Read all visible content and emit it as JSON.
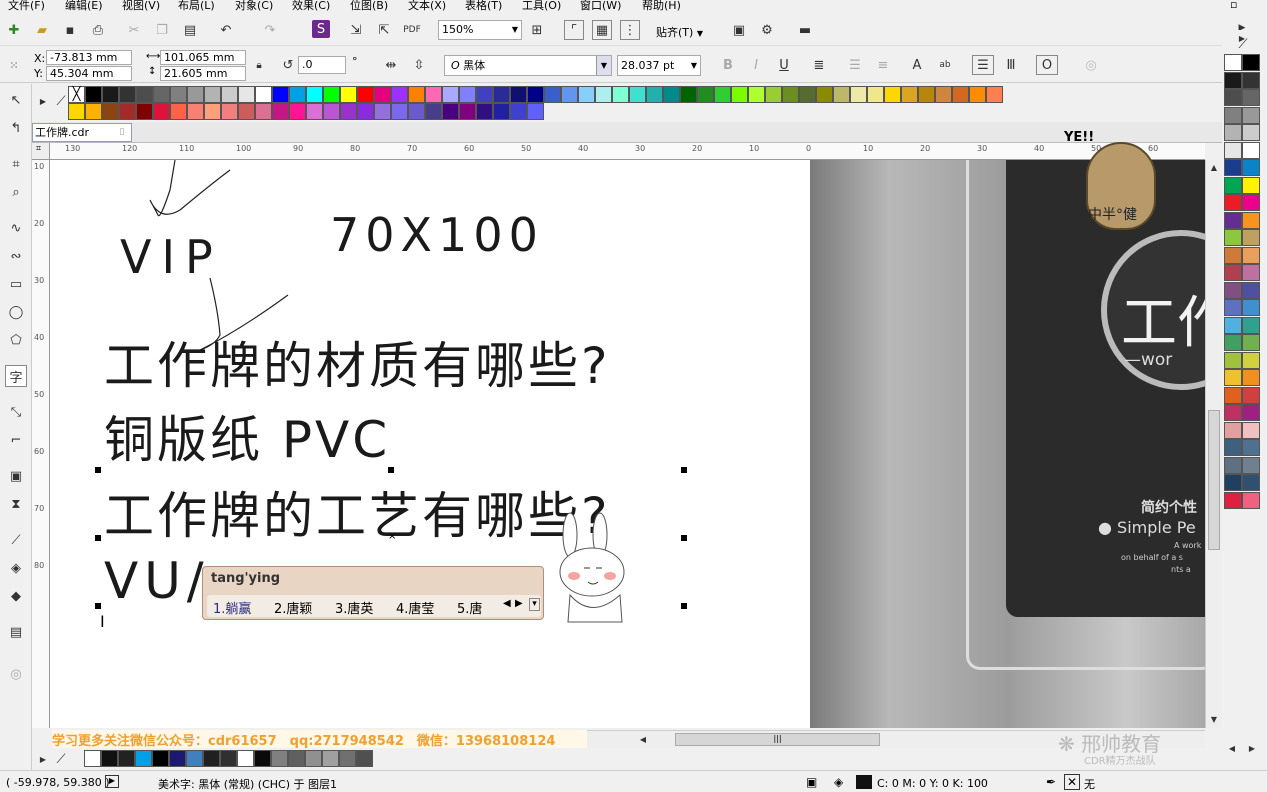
{
  "menu": [
    "文件(F)",
    "编辑(E)",
    "视图(V)",
    "布局(L)",
    "对象(C)",
    "效果(C)",
    "位图(B)",
    "文本(X)",
    "表格(T)",
    "工具(O)",
    "窗口(W)",
    "帮助(H)"
  ],
  "toolbar": {
    "zoom": "150%",
    "snap_label": "贴齐(T)"
  },
  "property_bar": {
    "x_label": "X:",
    "x_value": "-73.813 mm",
    "y_label": "Y:",
    "y_value": "45.304 mm",
    "width_value": "101.065 mm",
    "height_value": "21.605 mm",
    "rotation_value": ".0",
    "rotation_unit": "°",
    "font_name": "黑体",
    "font_size": "28.037 pt"
  },
  "doc_tab": "工作牌.cdr",
  "ruler_top": [
    "130",
    "120",
    "110",
    "100",
    "90",
    "80",
    "70",
    "60",
    "50",
    "40",
    "30",
    "20",
    "10",
    "0",
    "10",
    "20",
    "30",
    "40",
    "50",
    "60"
  ],
  "ruler_left": [
    "10",
    "20",
    "30",
    "40",
    "50",
    "60",
    "70",
    "80"
  ],
  "canvas_text": {
    "vip": "VIP",
    "size": "70X100",
    "line1": "工作牌的材质有哪些?",
    "line2": "铜版纸 PVC",
    "line3": "工作牌的工艺有哪些?",
    "line4": "VU/"
  },
  "ime": {
    "input": "tang'ying",
    "candidates": [
      "1.躺赢",
      "2.唐颖",
      "3.唐英",
      "4.唐莹",
      "5.唐"
    ]
  },
  "photo_text": {
    "title": "工作",
    "sub": "—wor",
    "cn_caption": "简约个性",
    "en_caption": "Simple Pe",
    "line_a": "A work",
    "line_b": "on behalf of a s",
    "line_c": "nts a"
  },
  "sticker_text": {
    "yeah": "YE!!",
    "tag": "中半°健"
  },
  "watermark": "学习更多关注微信公众号：cdr61657　qq:2717948542　微信：13968108124",
  "brand": "邢帅教育",
  "brand_sub": "CDR精万杰战队",
  "status": {
    "coords": "( -59.978, 59.380 )",
    "object_info": "美术字: 黑体 (常规) (CHC) 于 图层1",
    "fill": "C: 0 M: 0 Y: 0 K: 100",
    "outline": "无"
  },
  "colors": {
    "accent": "#1c6fc2",
    "canvas": "#ffffff",
    "photo_card": "#2b2b2b"
  }
}
